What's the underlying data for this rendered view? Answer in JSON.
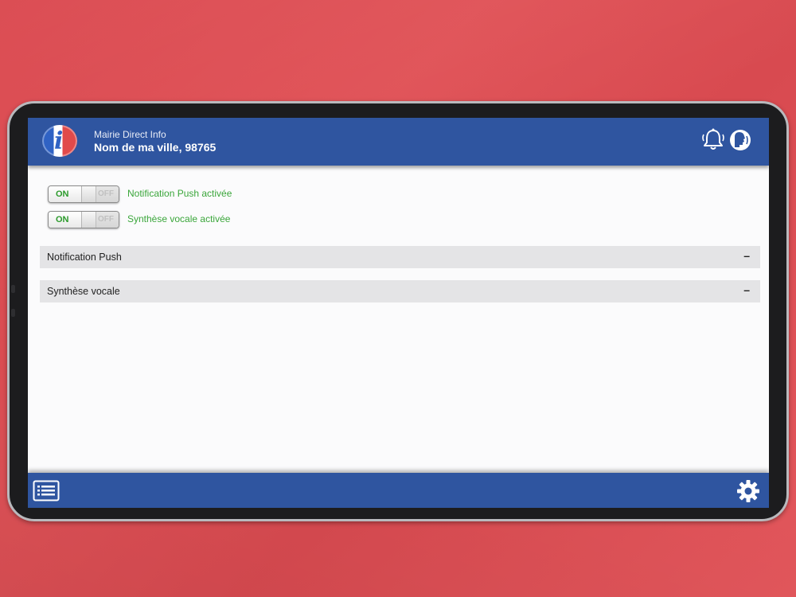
{
  "header": {
    "app_name": "Mairie Direct Info",
    "city": "Nom de ma ville, 98765"
  },
  "toggles": [
    {
      "on_label": "ON",
      "off_label": "OFF",
      "state": "on",
      "label": "Notification Push activée"
    },
    {
      "on_label": "ON",
      "off_label": "OFF",
      "state": "on",
      "label": "Synthèse vocale activée"
    }
  ],
  "sections": [
    {
      "title": "Notification Push",
      "toggle_glyph": "–"
    },
    {
      "title": "Synthèse vocale",
      "toggle_glyph": "–"
    }
  ],
  "icons": {
    "header_left": "app-logo-icon",
    "header_right": [
      "bell-icon",
      "voice-icon"
    ],
    "footer_left": "list-icon",
    "footer_right": "gear-icon"
  },
  "colors": {
    "bar_blue": "#2f55a0",
    "toggle_on_green": "#2b9a2b",
    "label_green": "#3aa63a",
    "background_red": "#d9434a"
  }
}
